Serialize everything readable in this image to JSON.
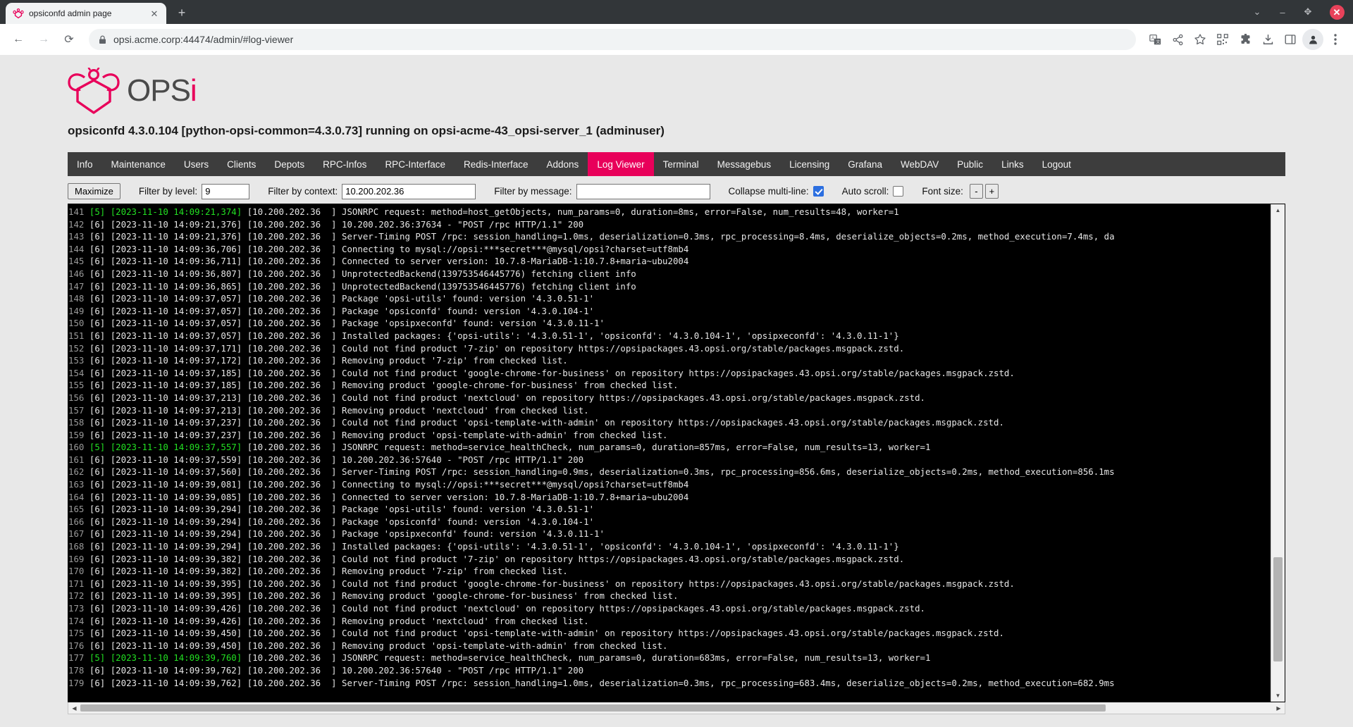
{
  "browser": {
    "tab": {
      "title": "opsiconfd admin page",
      "favicon": "opsi-bee-favicon",
      "close_label": "✕"
    },
    "new_tab_label": "+",
    "window_controls": {
      "minimize": "–",
      "maximize": "✥",
      "close": "✕",
      "dropdown": "⌄"
    },
    "nav": {
      "back": "←",
      "forward": "→",
      "reload": "⟳"
    },
    "omnibox": {
      "url": "opsi.acme.corp:44474/admin/#log-viewer",
      "lock_icon": "lock-icon"
    },
    "toolbar_icons": [
      "translate-icon",
      "share-icon",
      "bookmark-star-icon",
      "qr-code-icon",
      "extensions-puzzle-icon",
      "download-icon",
      "side-panel-icon",
      "profile-avatar-icon",
      "browser-menu-icon"
    ]
  },
  "site": {
    "logo_text": "OPS",
    "logo_accent_letter": "i",
    "accent_color": "#e8005a",
    "page_title": "opsiconfd 4.3.0.104 [python-opsi-common=4.3.0.73] running on opsi-acme-43_opsi-server_1 (adminuser)"
  },
  "nav_items": [
    {
      "label": "Info",
      "active": false
    },
    {
      "label": "Maintenance",
      "active": false
    },
    {
      "label": "Users",
      "active": false
    },
    {
      "label": "Clients",
      "active": false
    },
    {
      "label": "Depots",
      "active": false
    },
    {
      "label": "RPC-Infos",
      "active": false
    },
    {
      "label": "RPC-Interface",
      "active": false
    },
    {
      "label": "Redis-Interface",
      "active": false
    },
    {
      "label": "Addons",
      "active": false
    },
    {
      "label": "Log Viewer",
      "active": true
    },
    {
      "label": "Terminal",
      "active": false
    },
    {
      "label": "Messagebus",
      "active": false
    },
    {
      "label": "Licensing",
      "active": false
    },
    {
      "label": "Grafana",
      "active": false
    },
    {
      "label": "WebDAV",
      "active": false
    },
    {
      "label": "Public",
      "active": false
    },
    {
      "label": "Links",
      "active": false
    },
    {
      "label": "Logout",
      "active": false
    }
  ],
  "toolbar": {
    "maximize_label": "Maximize",
    "level_label": "Filter by level:",
    "level_value": "9",
    "context_label": "Filter by context:",
    "context_value": "10.200.202.36",
    "message_label": "Filter by message:",
    "message_value": "",
    "collapse_label": "Collapse multi-line:",
    "collapse_checked": true,
    "autoscroll_label": "Auto scroll:",
    "autoscroll_checked": false,
    "fontsize_label": "Font size:",
    "fontsize_minus": "-",
    "fontsize_plus": "+"
  },
  "log": {
    "scroll": {
      "vertical_thumb_top_pct": 72,
      "vertical_thumb_height_pct": 22,
      "horizontal_thumb_width_pct": 86
    },
    "lines": [
      {
        "n": "141",
        "level": "5",
        "ts": "[2023-11-10 14:09:21,374]",
        "ctx": "[10.200.202.36  ]",
        "msg": "JSONRPC request: method=host_getObjects, num_params=0, duration=8ms, error=False, num_results=48, worker=1"
      },
      {
        "n": "142",
        "level": "6",
        "ts": "[2023-11-10 14:09:21,376]",
        "ctx": "[10.200.202.36  ]",
        "msg": "10.200.202.36:37634 - \"POST /rpc HTTP/1.1\" 200"
      },
      {
        "n": "143",
        "level": "6",
        "ts": "[2023-11-10 14:09:21,376]",
        "ctx": "[10.200.202.36  ]",
        "msg": "Server-Timing POST /rpc: session_handling=1.0ms, deserialization=0.3ms, rpc_processing=8.4ms, deserialize_objects=0.2ms, method_execution=7.4ms, da"
      },
      {
        "n": "144",
        "level": "6",
        "ts": "[2023-11-10 14:09:36,706]",
        "ctx": "[10.200.202.36  ]",
        "msg": "Connecting to mysql://opsi:***secret***@mysql/opsi?charset=utf8mb4"
      },
      {
        "n": "145",
        "level": "6",
        "ts": "[2023-11-10 14:09:36,711]",
        "ctx": "[10.200.202.36  ]",
        "msg": "Connected to server version: 10.7.8-MariaDB-1:10.7.8+maria~ubu2004"
      },
      {
        "n": "146",
        "level": "6",
        "ts": "[2023-11-10 14:09:36,807]",
        "ctx": "[10.200.202.36  ]",
        "msg": "UnprotectedBackend(139753546445776) fetching client info"
      },
      {
        "n": "147",
        "level": "6",
        "ts": "[2023-11-10 14:09:36,865]",
        "ctx": "[10.200.202.36  ]",
        "msg": "UnprotectedBackend(139753546445776) fetching client info"
      },
      {
        "n": "148",
        "level": "6",
        "ts": "[2023-11-10 14:09:37,057]",
        "ctx": "[10.200.202.36  ]",
        "msg": "Package 'opsi-utils' found: version '4.3.0.51-1'"
      },
      {
        "n": "149",
        "level": "6",
        "ts": "[2023-11-10 14:09:37,057]",
        "ctx": "[10.200.202.36  ]",
        "msg": "Package 'opsiconfd' found: version '4.3.0.104-1'"
      },
      {
        "n": "150",
        "level": "6",
        "ts": "[2023-11-10 14:09:37,057]",
        "ctx": "[10.200.202.36  ]",
        "msg": "Package 'opsipxeconfd' found: version '4.3.0.11-1'"
      },
      {
        "n": "151",
        "level": "6",
        "ts": "[2023-11-10 14:09:37,057]",
        "ctx": "[10.200.202.36  ]",
        "msg": "Installed packages: {'opsi-utils': '4.3.0.51-1', 'opsiconfd': '4.3.0.104-1', 'opsipxeconfd': '4.3.0.11-1'}"
      },
      {
        "n": "152",
        "level": "6",
        "ts": "[2023-11-10 14:09:37,171]",
        "ctx": "[10.200.202.36  ]",
        "msg": "Could not find product '7-zip' on repository https://opsipackages.43.opsi.org/stable/packages.msgpack.zstd."
      },
      {
        "n": "153",
        "level": "6",
        "ts": "[2023-11-10 14:09:37,172]",
        "ctx": "[10.200.202.36  ]",
        "msg": "Removing product '7-zip' from checked list."
      },
      {
        "n": "154",
        "level": "6",
        "ts": "[2023-11-10 14:09:37,185]",
        "ctx": "[10.200.202.36  ]",
        "msg": "Could not find product 'google-chrome-for-business' on repository https://opsipackages.43.opsi.org/stable/packages.msgpack.zstd."
      },
      {
        "n": "155",
        "level": "6",
        "ts": "[2023-11-10 14:09:37,185]",
        "ctx": "[10.200.202.36  ]",
        "msg": "Removing product 'google-chrome-for-business' from checked list."
      },
      {
        "n": "156",
        "level": "6",
        "ts": "[2023-11-10 14:09:37,213]",
        "ctx": "[10.200.202.36  ]",
        "msg": "Could not find product 'nextcloud' on repository https://opsipackages.43.opsi.org/stable/packages.msgpack.zstd."
      },
      {
        "n": "157",
        "level": "6",
        "ts": "[2023-11-10 14:09:37,213]",
        "ctx": "[10.200.202.36  ]",
        "msg": "Removing product 'nextcloud' from checked list."
      },
      {
        "n": "158",
        "level": "6",
        "ts": "[2023-11-10 14:09:37,237]",
        "ctx": "[10.200.202.36  ]",
        "msg": "Could not find product 'opsi-template-with-admin' on repository https://opsipackages.43.opsi.org/stable/packages.msgpack.zstd."
      },
      {
        "n": "159",
        "level": "6",
        "ts": "[2023-11-10 14:09:37,237]",
        "ctx": "[10.200.202.36  ]",
        "msg": "Removing product 'opsi-template-with-admin' from checked list."
      },
      {
        "n": "160",
        "level": "5",
        "ts": "[2023-11-10 14:09:37,557]",
        "ctx": "[10.200.202.36  ]",
        "msg": "JSONRPC request: method=service_healthCheck, num_params=0, duration=857ms, error=False, num_results=13, worker=1"
      },
      {
        "n": "161",
        "level": "6",
        "ts": "[2023-11-10 14:09:37,559]",
        "ctx": "[10.200.202.36  ]",
        "msg": "10.200.202.36:57640 - \"POST /rpc HTTP/1.1\" 200"
      },
      {
        "n": "162",
        "level": "6",
        "ts": "[2023-11-10 14:09:37,560]",
        "ctx": "[10.200.202.36  ]",
        "msg": "Server-Timing POST /rpc: session_handling=0.9ms, deserialization=0.3ms, rpc_processing=856.6ms, deserialize_objects=0.2ms, method_execution=856.1ms"
      },
      {
        "n": "163",
        "level": "6",
        "ts": "[2023-11-10 14:09:39,081]",
        "ctx": "[10.200.202.36  ]",
        "msg": "Connecting to mysql://opsi:***secret***@mysql/opsi?charset=utf8mb4"
      },
      {
        "n": "164",
        "level": "6",
        "ts": "[2023-11-10 14:09:39,085]",
        "ctx": "[10.200.202.36  ]",
        "msg": "Connected to server version: 10.7.8-MariaDB-1:10.7.8+maria~ubu2004"
      },
      {
        "n": "165",
        "level": "6",
        "ts": "[2023-11-10 14:09:39,294]",
        "ctx": "[10.200.202.36  ]",
        "msg": "Package 'opsi-utils' found: version '4.3.0.51-1'"
      },
      {
        "n": "166",
        "level": "6",
        "ts": "[2023-11-10 14:09:39,294]",
        "ctx": "[10.200.202.36  ]",
        "msg": "Package 'opsiconfd' found: version '4.3.0.104-1'"
      },
      {
        "n": "167",
        "level": "6",
        "ts": "[2023-11-10 14:09:39,294]",
        "ctx": "[10.200.202.36  ]",
        "msg": "Package 'opsipxeconfd' found: version '4.3.0.11-1'"
      },
      {
        "n": "168",
        "level": "6",
        "ts": "[2023-11-10 14:09:39,294]",
        "ctx": "[10.200.202.36  ]",
        "msg": "Installed packages: {'opsi-utils': '4.3.0.51-1', 'opsiconfd': '4.3.0.104-1', 'opsipxeconfd': '4.3.0.11-1'}"
      },
      {
        "n": "169",
        "level": "6",
        "ts": "[2023-11-10 14:09:39,382]",
        "ctx": "[10.200.202.36  ]",
        "msg": "Could not find product '7-zip' on repository https://opsipackages.43.opsi.org/stable/packages.msgpack.zstd."
      },
      {
        "n": "170",
        "level": "6",
        "ts": "[2023-11-10 14:09:39,382]",
        "ctx": "[10.200.202.36  ]",
        "msg": "Removing product '7-zip' from checked list."
      },
      {
        "n": "171",
        "level": "6",
        "ts": "[2023-11-10 14:09:39,395]",
        "ctx": "[10.200.202.36  ]",
        "msg": "Could not find product 'google-chrome-for-business' on repository https://opsipackages.43.opsi.org/stable/packages.msgpack.zstd."
      },
      {
        "n": "172",
        "level": "6",
        "ts": "[2023-11-10 14:09:39,395]",
        "ctx": "[10.200.202.36  ]",
        "msg": "Removing product 'google-chrome-for-business' from checked list."
      },
      {
        "n": "173",
        "level": "6",
        "ts": "[2023-11-10 14:09:39,426]",
        "ctx": "[10.200.202.36  ]",
        "msg": "Could not find product 'nextcloud' on repository https://opsipackages.43.opsi.org/stable/packages.msgpack.zstd."
      },
      {
        "n": "174",
        "level": "6",
        "ts": "[2023-11-10 14:09:39,426]",
        "ctx": "[10.200.202.36  ]",
        "msg": "Removing product 'nextcloud' from checked list."
      },
      {
        "n": "175",
        "level": "6",
        "ts": "[2023-11-10 14:09:39,450]",
        "ctx": "[10.200.202.36  ]",
        "msg": "Could not find product 'opsi-template-with-admin' on repository https://opsipackages.43.opsi.org/stable/packages.msgpack.zstd."
      },
      {
        "n": "176",
        "level": "6",
        "ts": "[2023-11-10 14:09:39,450]",
        "ctx": "[10.200.202.36  ]",
        "msg": "Removing product 'opsi-template-with-admin' from checked list."
      },
      {
        "n": "177",
        "level": "5",
        "ts": "[2023-11-10 14:09:39,760]",
        "ctx": "[10.200.202.36  ]",
        "msg": "JSONRPC request: method=service_healthCheck, num_params=0, duration=683ms, error=False, num_results=13, worker=1"
      },
      {
        "n": "178",
        "level": "6",
        "ts": "[2023-11-10 14:09:39,762]",
        "ctx": "[10.200.202.36  ]",
        "msg": "10.200.202.36:57640 - \"POST /rpc HTTP/1.1\" 200"
      },
      {
        "n": "179",
        "level": "6",
        "ts": "[2023-11-10 14:09:39,762]",
        "ctx": "[10.200.202.36  ]",
        "msg": "Server-Timing POST /rpc: session_handling=1.0ms, deserialization=0.3ms, rpc_processing=683.4ms, deserialize_objects=0.2ms, method_execution=682.9ms"
      }
    ]
  }
}
